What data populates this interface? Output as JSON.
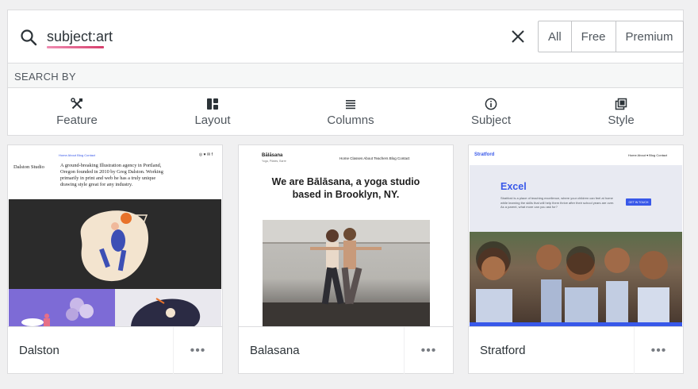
{
  "search": {
    "query": "subject:art",
    "filters": [
      "All",
      "Free",
      "Premium"
    ]
  },
  "search_by": {
    "label": "SEARCH BY",
    "items": [
      {
        "label": "Feature",
        "icon": "tools-icon"
      },
      {
        "label": "Layout",
        "icon": "layout-icon"
      },
      {
        "label": "Columns",
        "icon": "columns-icon"
      },
      {
        "label": "Subject",
        "icon": "info-icon"
      },
      {
        "label": "Style",
        "icon": "style-icon"
      }
    ]
  },
  "themes": [
    {
      "name": "Dalston",
      "preview": {
        "brand": "Dalston Studio",
        "nav": "Home   About   Blog   Contact",
        "social": "◎ ♥ ✉ f",
        "description": "A ground-breaking Illustration agency in Portland, Oregon founded in 2010 by Greg Dalston. Working primarily in print and web he has a truly unique drawing style great for any industry."
      }
    },
    {
      "name": "Balasana",
      "preview": {
        "logo": "Bālāsana",
        "tagline": "Yoga, Pilates, Barre",
        "nav": "Home   Classes   About   Teachers   Blog   Contact",
        "headline_line1": "We are Bālāsana, a yoga studio",
        "headline_line2": "based in Brooklyn, NY."
      }
    },
    {
      "name": "Stratford",
      "preview": {
        "logo": "Stratford",
        "nav": "Home   About ▾   Blog   Contact",
        "title": "Excel",
        "description": "Stratford is a place of teaching excellence, where your children can feel at home while learning the skills that will help them thrive after their school years are over. As a parent, what more can you ask for?",
        "button": "GET IN TOUCH"
      }
    }
  ],
  "more_label": "•••",
  "colors": {
    "accent": "#3858e9",
    "underline_start": "#f08eb3",
    "underline_end": "#d63e6b"
  }
}
